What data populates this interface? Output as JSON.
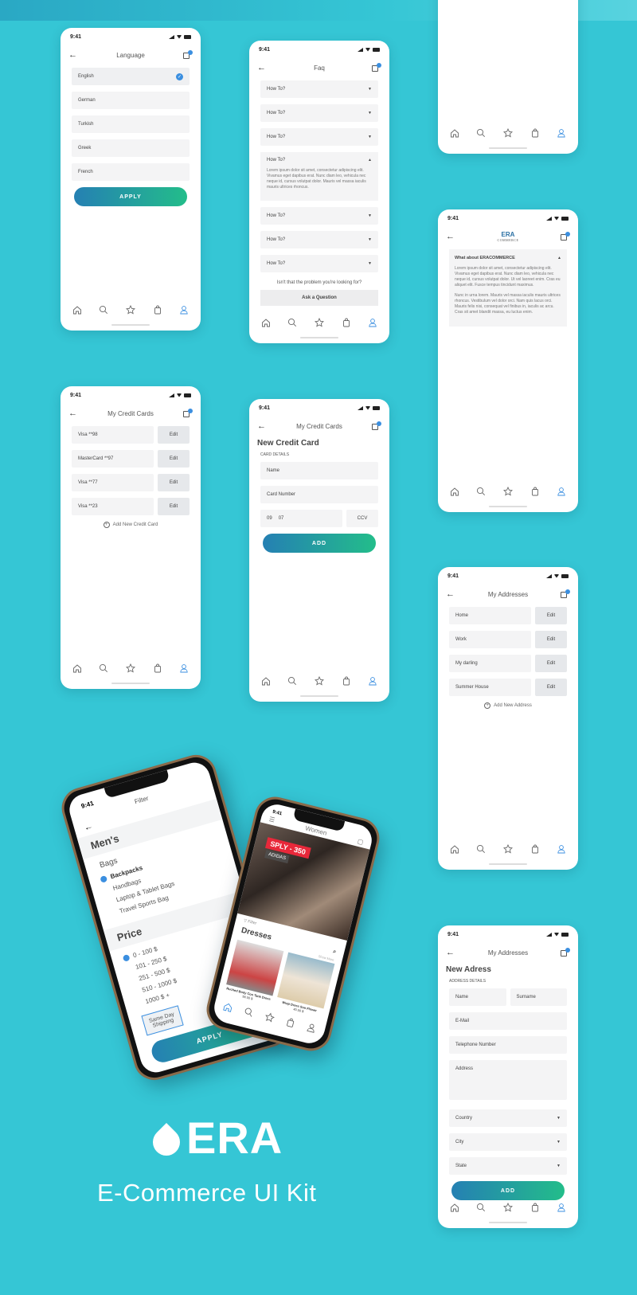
{
  "status_time": "9:41",
  "language": {
    "title": "Language",
    "items": [
      "English",
      "German",
      "Turkish",
      "Greek",
      "French"
    ],
    "selected": "English",
    "apply": "APPLY"
  },
  "faq": {
    "title": "Faq",
    "q": "How To?",
    "answer": "Lorem ipsum dolor sit amet, consectetur adipiscing elit. Vivamus eget dapibus erat. Nunc diam leo, vehicula nec neque id, cursus volutpat dolor.  Mauris vel massa iaculis mauris ultrices rhoncus.",
    "problem": "Isn't that the problem you're looking for?",
    "ask": "Ask a Question"
  },
  "about": {
    "logo": "ERA",
    "logo_sub": "COMMERCE",
    "heading": "What about ERACOMMERCE",
    "p1": "Lorem ipsum dolor sit amet, consectetur adipiscing elit. Vivamus eget dapibus erat. Nunc diam leo, vehicula nec neque id, cursus volutpat dolor. Ut vel laoreet enim. Cras eu aliquet elit. Fusce tempus tincidunt maximus.",
    "p2": "Nunc in urna lorem. Mauris vel massa iaculis mauris ultrices rhoncus. Vestibulum vel dolor orci. Nam quis lacus orci. Mauris felis nisi, consequat vel finibus in, iaculis ac arcu. Cras sit amet blandit massa, eu luctus enim."
  },
  "cards": {
    "title": "My Credit Cards",
    "items": [
      "Visa **98",
      "MasterCard **97",
      "Visa **77",
      "Visa **23"
    ],
    "edit": "Edit",
    "add": "Add New Credit Card"
  },
  "new_card": {
    "title": "My Credit Cards",
    "heading": "New Credit Card",
    "section": "CARD DETAILS",
    "name": "Name",
    "number": "Card Number",
    "month": "09",
    "year": "07",
    "ccv": "CCV",
    "add": "ADD"
  },
  "addresses": {
    "title": "My Addresses",
    "items": [
      "Home",
      "Work",
      "My darling",
      "Summer House"
    ],
    "edit": "Edit",
    "add": "Add New Address"
  },
  "new_address": {
    "title": "My Addresses",
    "heading": "New Adress",
    "section": "ADDRESS DETAILS",
    "name": "Name",
    "surname": "Surname",
    "email": "E-Mail",
    "phone": "Telephone Number",
    "address": "Address",
    "country": "Country",
    "city": "City",
    "state": "State",
    "add": "ADD"
  },
  "filter": {
    "title": "Filter",
    "category": "Men's",
    "sub": "Bags",
    "options": [
      "Backpacks",
      "Handbags",
      "Laptop & Tablet Bags",
      "Travel Sports Bag"
    ],
    "selected_option": "Backpacks",
    "price_title": "Price",
    "prices": [
      "0 - 100 $",
      "101 - 250 $",
      "251 - 500 $",
      "510 - 1000 $",
      "1000 $ +"
    ],
    "selected_price": "0 - 100 $",
    "shipping": "Same Day Shipping",
    "apply": "APPLY"
  },
  "women": {
    "title": "Women",
    "sale": "SPLY - 350",
    "brand": "ADIDAS",
    "filter": "Filter",
    "section": "Dresses",
    "show_more": "Show More",
    "products": [
      {
        "name": "Ruched Body Con Tank Dress",
        "price": "94.00 $"
      },
      {
        "name": "Wrap Dress Sun Flower",
        "price": "40.00 $"
      }
    ]
  },
  "brand": {
    "logo": "ERA",
    "tagline": "E-Commerce UI Kit"
  },
  "colors": {
    "background": "#35c6d5",
    "accent": "#3b8fe0",
    "gradient_start": "#2580b3",
    "gradient_end": "#23bd8a",
    "sale": "#e8283a"
  },
  "nav_icons": [
    "home-icon",
    "search-icon",
    "star-icon",
    "bag-icon",
    "user-icon"
  ]
}
